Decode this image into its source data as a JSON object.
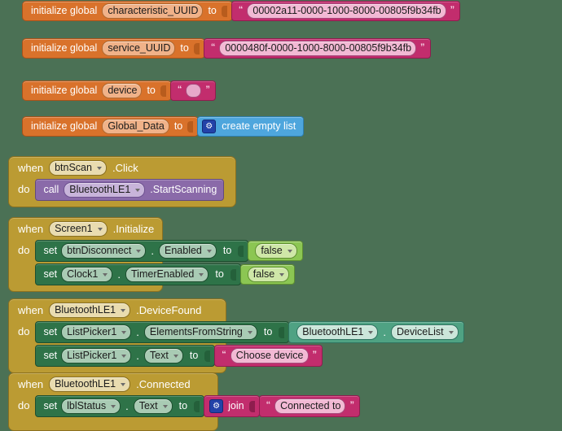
{
  "workspace": {
    "background_color": "#4b7155",
    "app": "MIT App Inventor Blocks Editor"
  },
  "palette": {
    "variable_orange": "#d9722b",
    "text_magenta": "#c22d6d",
    "list_blue": "#4ea6dd",
    "event_gold": "#bb9b33",
    "call_purple": "#8a6aa9",
    "setter_green": "#2e7348",
    "getter_green": "#4fa283",
    "logic_green": "#8cc653"
  },
  "globals": [
    {
      "keyword": "initialize global",
      "name": "characteristic_UUID",
      "to_label": "to",
      "value_kind": "text",
      "value": "00002a11-0000-1000-8000-00805f9b34fb"
    },
    {
      "keyword": "initialize global",
      "name": "service_UUID",
      "to_label": "to",
      "value_kind": "text",
      "value": "0000480f-0000-1000-8000-00805f9b34fb"
    },
    {
      "keyword": "initialize global",
      "name": "device",
      "to_label": "to",
      "value_kind": "text_empty",
      "value": ""
    },
    {
      "keyword": "initialize global",
      "name": "Global_Data",
      "to_label": "to",
      "value_kind": "list",
      "value": "create empty list",
      "gear_icon": "gear-icon"
    }
  ],
  "events": [
    {
      "when_label": "when",
      "component": "btnScan",
      "event": ".Click",
      "do_label": "do",
      "statements": [
        {
          "kind": "call",
          "call_label": "call",
          "component": "BluetoothLE1",
          "method": ".StartScanning"
        }
      ]
    },
    {
      "when_label": "when",
      "component": "Screen1",
      "event": ".Initialize",
      "do_label": "do",
      "statements": [
        {
          "kind": "set",
          "set_label": "set",
          "component": "btnDisconnect",
          "property": "Enabled",
          "to_label": "to",
          "value_kind": "logic",
          "value": "false"
        },
        {
          "kind": "set",
          "set_label": "set",
          "component": "Clock1",
          "property": "TimerEnabled",
          "to_label": "to",
          "value_kind": "logic",
          "value": "false"
        }
      ]
    },
    {
      "when_label": "when",
      "component": "BluetoothLE1",
      "event": ".DeviceFound",
      "do_label": "do",
      "statements": [
        {
          "kind": "set",
          "set_label": "set",
          "component": "ListPicker1",
          "property": "ElementsFromString",
          "to_label": "to",
          "value_kind": "getter",
          "getter_component": "BluetoothLE1",
          "getter_property": "DeviceList"
        },
        {
          "kind": "set",
          "set_label": "set",
          "component": "ListPicker1",
          "property": "Text",
          "to_label": "to",
          "value_kind": "text",
          "value": "Choose device"
        }
      ]
    },
    {
      "when_label": "when",
      "component": "BluetoothLE1",
      "event": ".Connected",
      "do_label": "do",
      "statements": [
        {
          "kind": "set",
          "set_label": "set",
          "component": "lblStatus",
          "property": "Text",
          "to_label": "to",
          "value_kind": "join",
          "join_label": "join",
          "gear_icon": "gear-icon",
          "value": "Connected to "
        }
      ]
    }
  ]
}
